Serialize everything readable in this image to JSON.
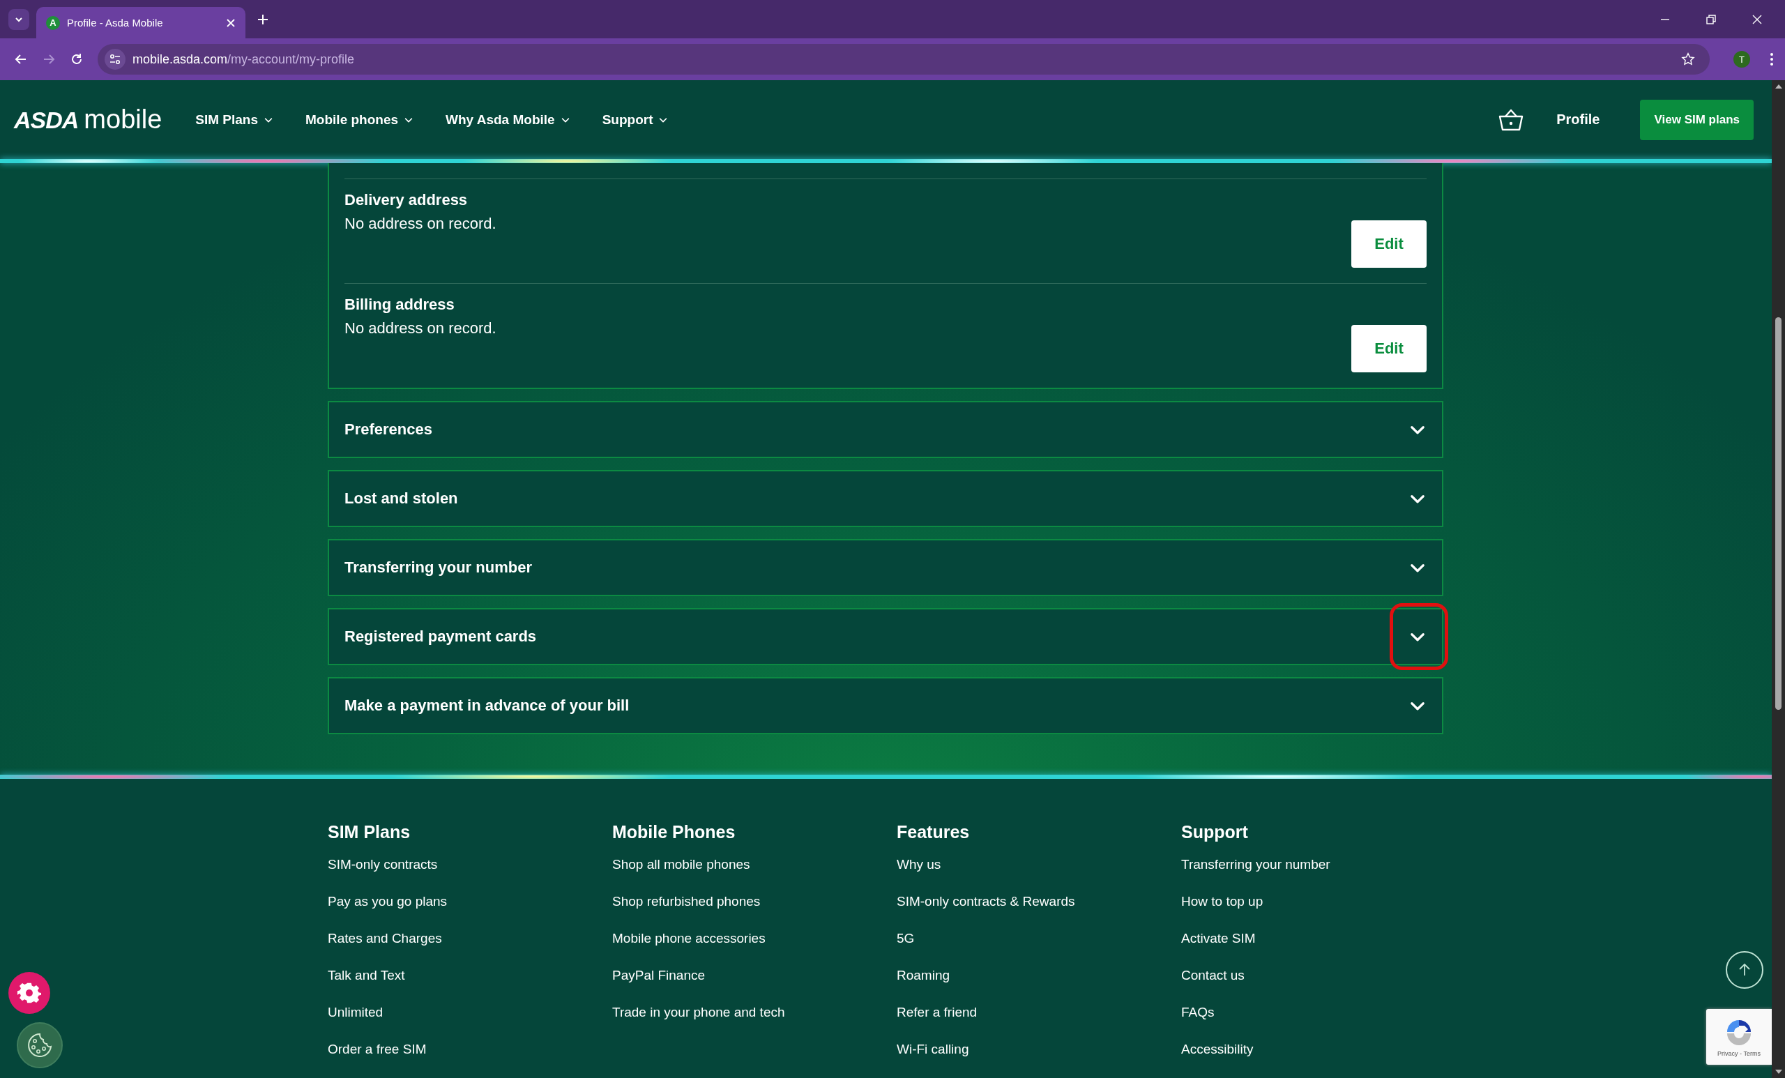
{
  "browser": {
    "tab_title": "Profile - Asda Mobile",
    "favicon_letter": "A",
    "url_host": "mobile.asda.com",
    "url_path": "/my-account/my-profile",
    "profile_initial": "T"
  },
  "header": {
    "logo_brand": "ASDA",
    "logo_suffix": "mobile",
    "nav": [
      {
        "label": "SIM Plans"
      },
      {
        "label": "Mobile phones"
      },
      {
        "label": "Why Asda Mobile"
      },
      {
        "label": "Support"
      }
    ],
    "profile": "Profile",
    "cta": "View SIM plans"
  },
  "address_card": {
    "rows": [
      {
        "title": "Delivery address",
        "value": "No address on record.",
        "button": "Edit"
      },
      {
        "title": "Billing address",
        "value": "No address on record.",
        "button": "Edit"
      }
    ]
  },
  "accordions": [
    {
      "title": "Preferences",
      "expanded": false,
      "highlighted": false
    },
    {
      "title": "Lost and stolen",
      "expanded": false,
      "highlighted": false
    },
    {
      "title": "Transferring your number",
      "expanded": false,
      "highlighted": false
    },
    {
      "title": "Registered payment cards",
      "expanded": false,
      "highlighted": true
    },
    {
      "title": "Make a payment in advance of your bill",
      "expanded": false,
      "highlighted": false
    }
  ],
  "footer": {
    "columns": [
      {
        "heading": "SIM Plans",
        "links": [
          "SIM-only contracts",
          "Pay as you go plans",
          "Rates and Charges",
          "Talk and Text",
          "Unlimited",
          "Order a free SIM"
        ]
      },
      {
        "heading": "Mobile Phones",
        "links": [
          "Shop all mobile phones",
          "Shop refurbished phones",
          "Mobile phone accessories",
          "PayPal Finance",
          "Trade in your phone and tech"
        ]
      },
      {
        "heading": "Features",
        "links": [
          "Why us",
          "SIM-only contracts & Rewards",
          "5G",
          "Roaming",
          "Refer a friend",
          "Wi-Fi calling"
        ]
      },
      {
        "heading": "Support",
        "links": [
          "Transferring your number",
          "How to top up",
          "Activate SIM",
          "Contact us",
          "FAQs",
          "Accessibility"
        ]
      }
    ]
  },
  "recaptcha": {
    "label": "Privacy - Terms"
  }
}
